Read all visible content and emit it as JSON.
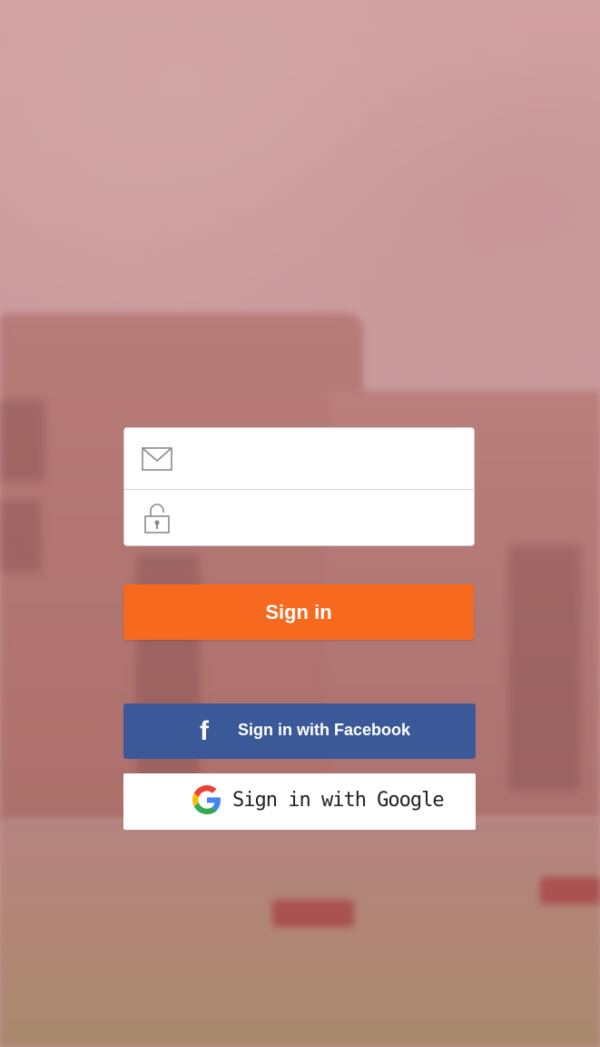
{
  "login_form": {
    "email": {
      "value": "",
      "placeholder": "",
      "icon": "envelope-icon"
    },
    "password": {
      "value": "",
      "placeholder": "",
      "icon": "lock-icon"
    }
  },
  "buttons": {
    "sign_in_label": "Sign in",
    "facebook_label": "Sign in with Facebook",
    "facebook_icon_glyph": "f",
    "google_label": "Sign in with Google"
  },
  "colors": {
    "sign_in": "#f7691f",
    "facebook": "#3b5998",
    "google_bg": "#ffffff"
  }
}
